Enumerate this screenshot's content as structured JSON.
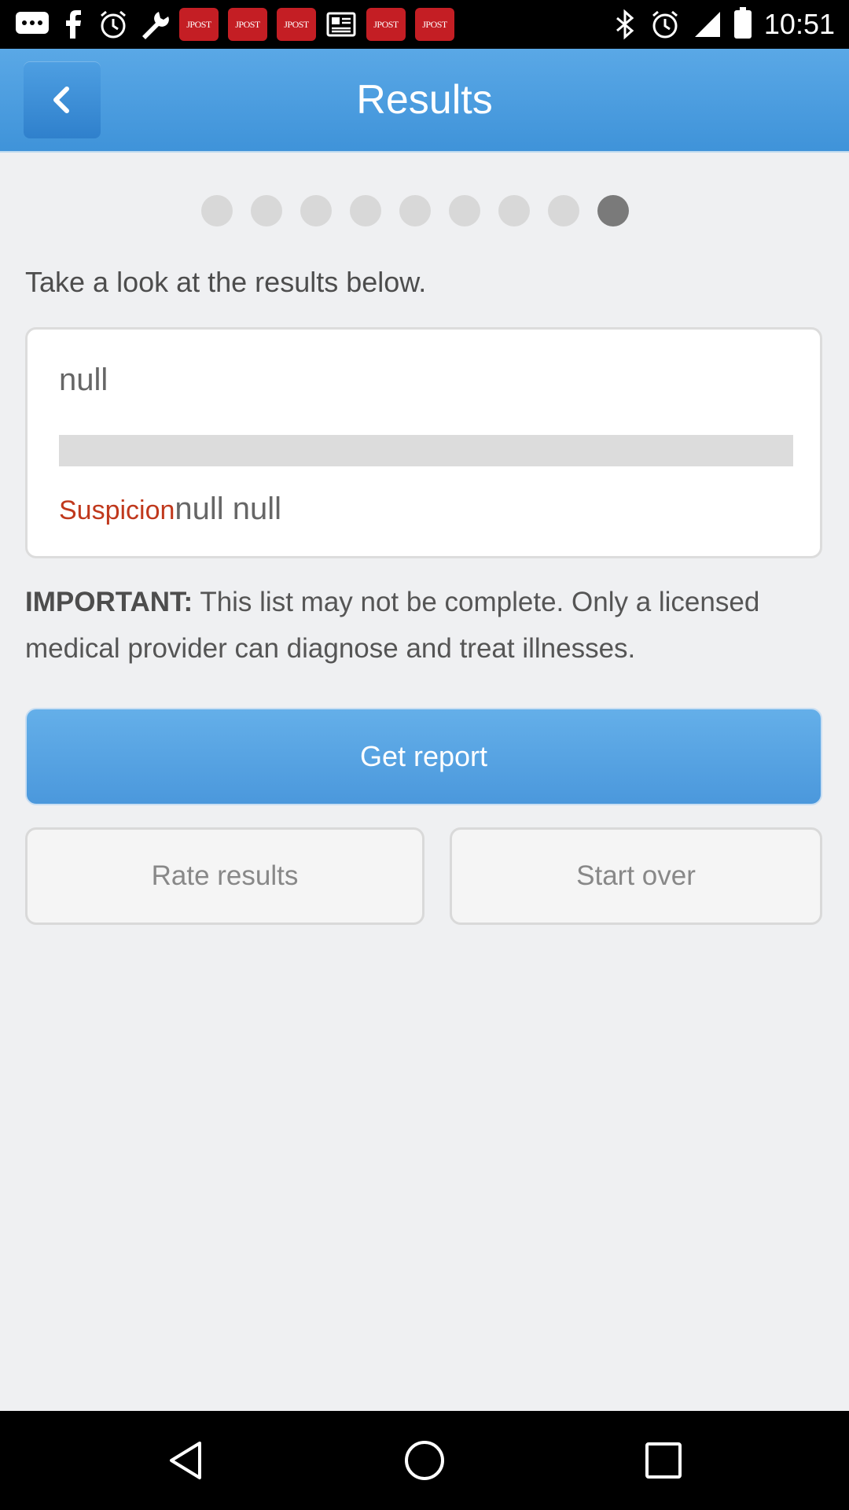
{
  "status_bar": {
    "left_icons": [
      "messages-icon",
      "facebook-icon",
      "alarm-icon",
      "wrench-icon",
      "jpost-icon",
      "jpost-icon",
      "jpost-icon",
      "news-icon",
      "jpost-icon",
      "jpost-icon"
    ],
    "jpost_label": "JPOST",
    "time": "10:51"
  },
  "app_bar": {
    "title": "Results"
  },
  "progress": {
    "total_steps": 9,
    "current_step": 9
  },
  "intro_text": "Take a look at the results below.",
  "result_card": {
    "title": "null",
    "suspicion_label": "Suspicion",
    "subtitle": "null null"
  },
  "notice": {
    "label": "IMPORTANT:",
    "text": "This list may not be complete. Only a licensed medical provider can diagnose and treat illnesses."
  },
  "buttons": {
    "get_report": "Get report",
    "rate_results": "Rate results",
    "start_over": "Start over"
  },
  "colors": {
    "app_bar": "#3f93d9",
    "primary_button": "#4b98dc",
    "suspicion": "#c0381c",
    "background": "#eff0f2"
  }
}
